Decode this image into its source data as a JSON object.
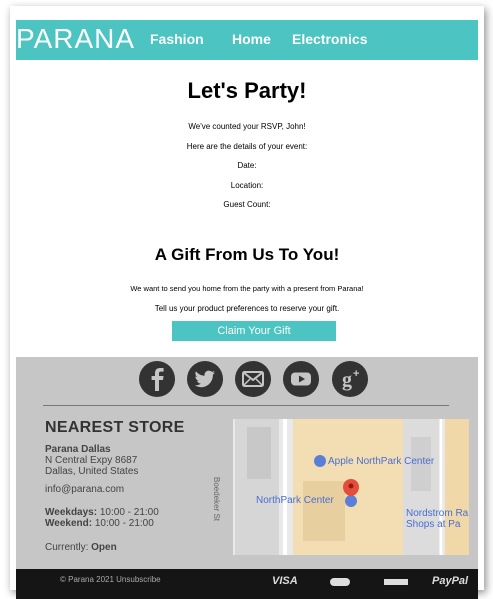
{
  "header": {
    "logo": "PARANA",
    "nav": [
      "Fashion",
      "Home",
      "Electronics"
    ]
  },
  "party": {
    "title": "Let's Party!",
    "rsvp_line": "We've counted your RSVP,  John!",
    "details_line": "Here are the details of your event:",
    "date_label": "Date:",
    "location_label": "Location:",
    "guest_label": "Guest Count:"
  },
  "gift": {
    "title": "A Gift From Us To You!",
    "line1": "We want to send you home from the party with a present from Parana!",
    "line2": "Tell us your product preferences to reserve your gift.",
    "button": "Claim Your Gift"
  },
  "social": [
    "facebook-icon",
    "twitter-icon",
    "mail-icon",
    "youtube-icon",
    "google-plus-icon"
  ],
  "store": {
    "title": "NEAREST STORE",
    "name": "Parana Dallas",
    "address1": "N Central Expy 8687",
    "address2": "Dallas, United States",
    "email": "info@parana.com",
    "weekdays_label": "Weekdays:",
    "weekdays_hours": "10:00 - 21:00",
    "weekend_label": "Weekend:",
    "weekend_hours": "10:00 - 21:00",
    "status_label": "Currently:",
    "status_value": "Open"
  },
  "map": {
    "place1": "Apple NorthPark Center",
    "place2": "NorthPark Center",
    "place3_line1": "Nordstrom Ra",
    "place3_line2": "Shops at Pa",
    "street": "Boedeker St"
  },
  "footer": {
    "copyright": "© Parana 2021   Unsubscribe",
    "payments": [
      "VISA",
      "PayPal"
    ]
  },
  "colors": {
    "brand": "#4cc4c2",
    "footer_bg": "#c6c6c6"
  }
}
